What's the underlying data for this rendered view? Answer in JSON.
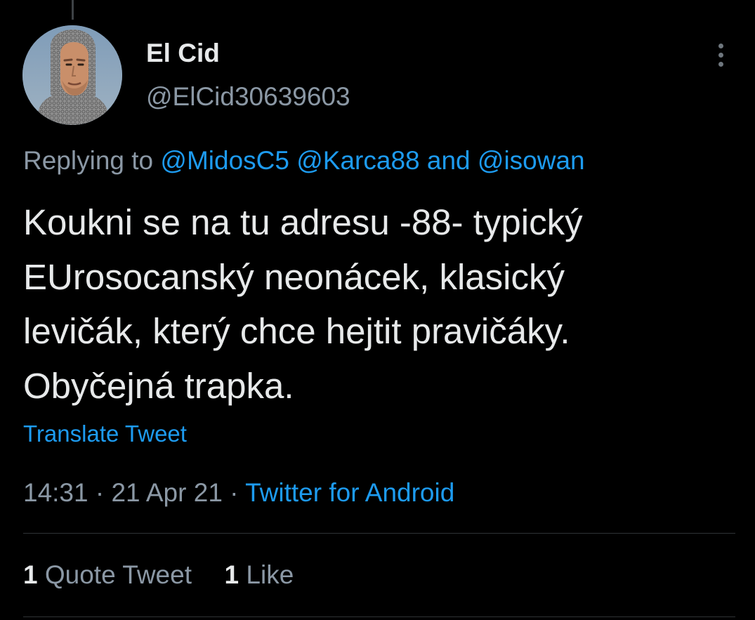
{
  "tweet": {
    "author": {
      "display_name": "El Cid",
      "handle": "@ElCid30639603"
    },
    "reply_context": {
      "prefix": "Replying to",
      "mention_1": "@MidosC5",
      "mention_2": "@Karca88",
      "conjunction": "and",
      "mention_3": "@isowan"
    },
    "text": "Koukni se na tu adresu -88- typický\nEUrosocanský neonácek, klasický\nlevičák, který chce hejtit pravičáky.\nObyčejná trapka.",
    "translate_label": "Translate Tweet",
    "time": "14:31",
    "date": "21 Apr 21",
    "separator": "·",
    "source": "Twitter for Android",
    "stats": {
      "quote_tweets_count": "1",
      "quote_tweets_label": "Quote Tweet",
      "likes_count": "1",
      "likes_label": "Like"
    }
  },
  "icons": {
    "more": "more-vertical-icon",
    "avatar": "profile-photo"
  },
  "colors": {
    "background": "#000000",
    "text_primary": "#e7e9ea",
    "text_secondary": "#8b98a5",
    "link": "#1d9bf0",
    "divider": "#2f3336"
  }
}
